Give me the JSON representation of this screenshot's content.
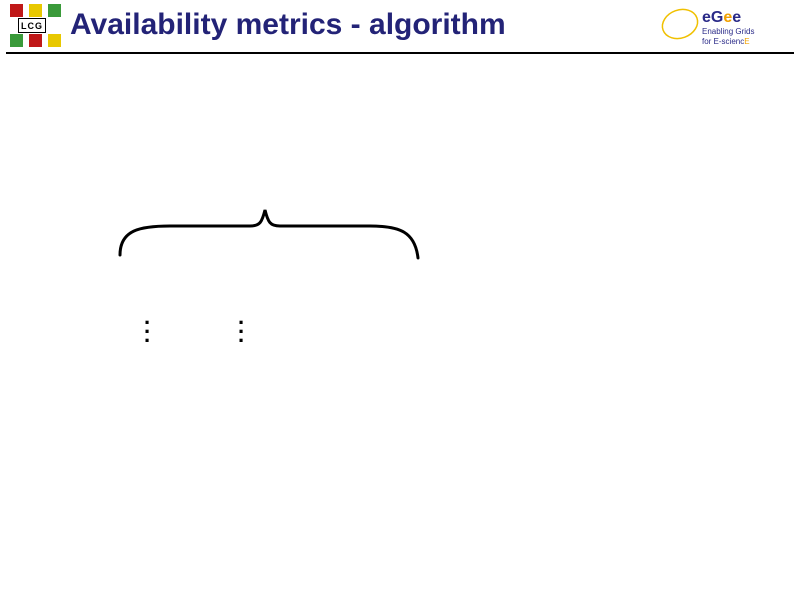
{
  "header": {
    "title": "Availability metrics - algorithm",
    "lcg_label": "LCG",
    "egee": {
      "brand": "eGee",
      "tagline1": "Enabling Grids",
      "tagline2": "for E-sciencE"
    }
  },
  "diagram": {
    "brace_present": true,
    "vertical_ellipsis_count": 2
  }
}
